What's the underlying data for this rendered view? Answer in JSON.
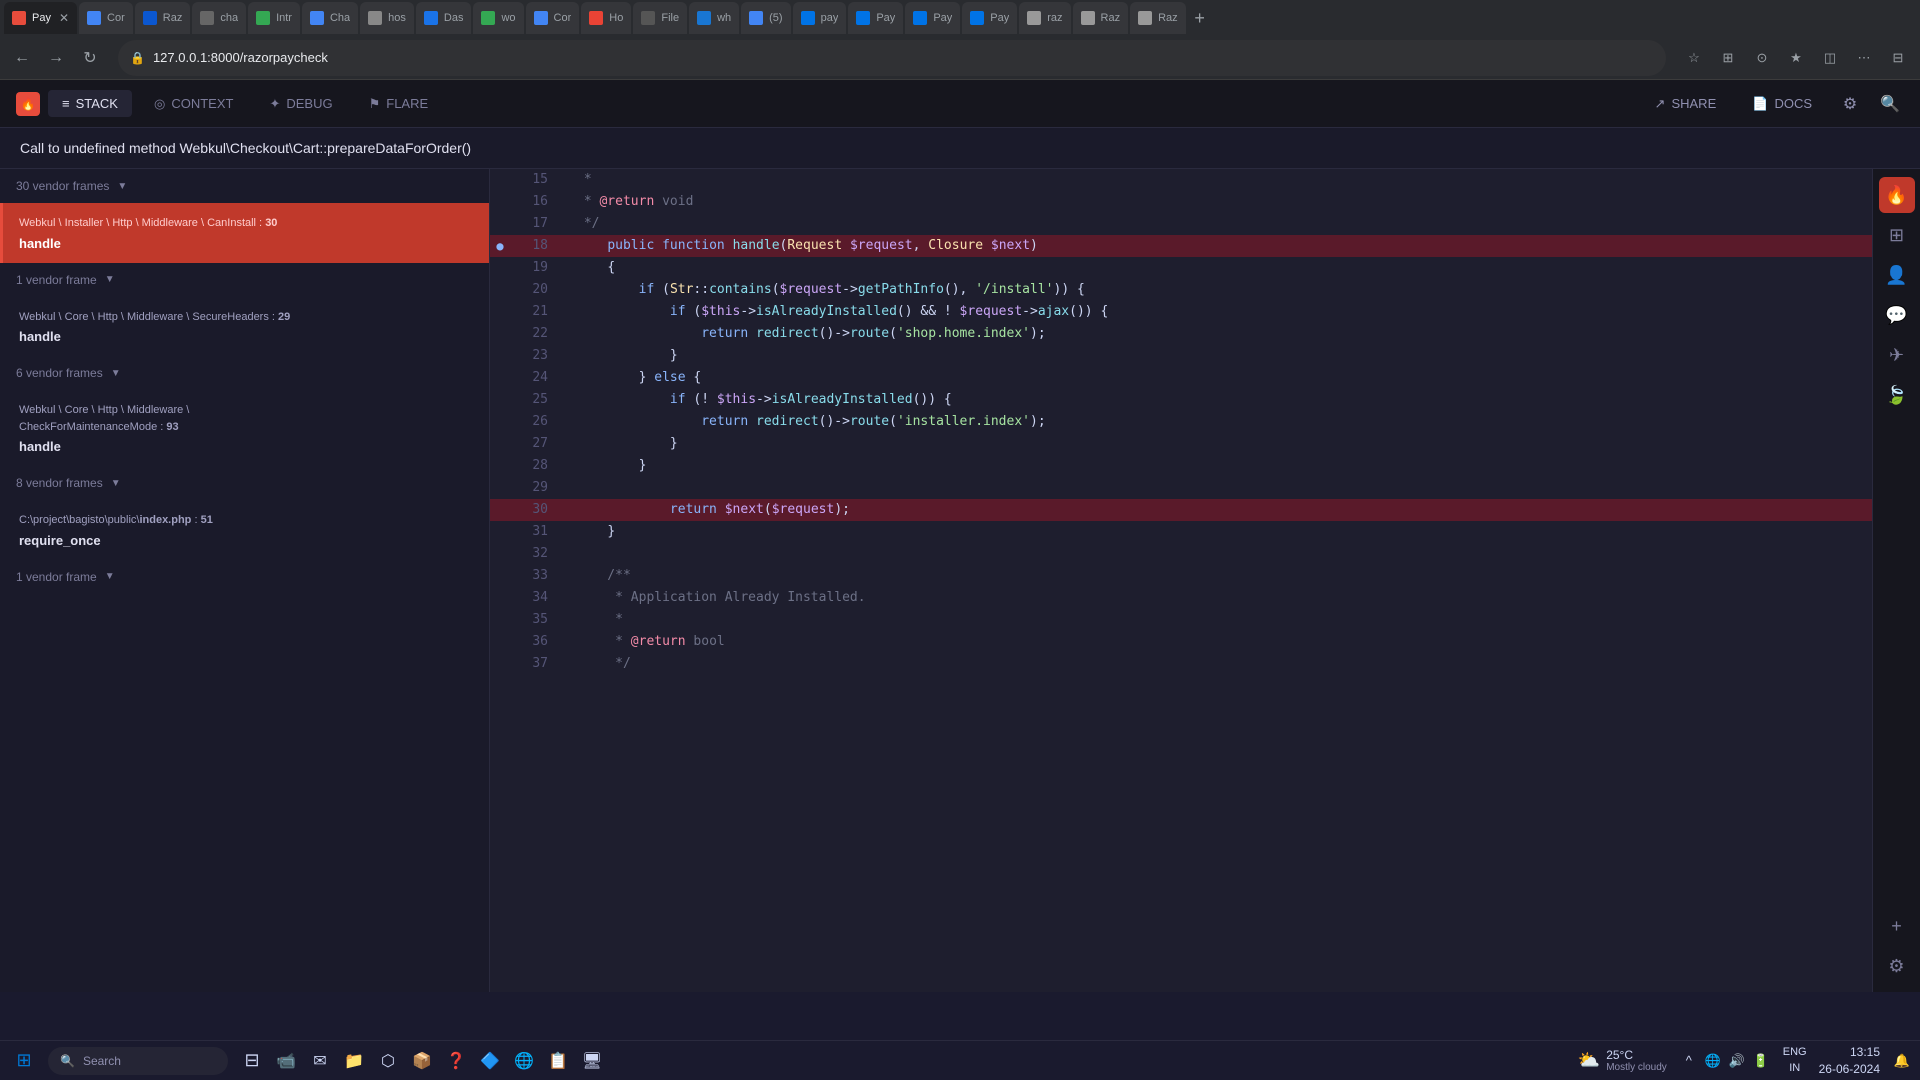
{
  "browser": {
    "url": "127.0.0.1:8000/razorpaycheck",
    "tabs": [
      {
        "label": "Cor",
        "active": false
      },
      {
        "label": "Raz",
        "active": false
      },
      {
        "label": "cha",
        "active": false
      },
      {
        "label": "Intr",
        "active": false
      },
      {
        "label": "Cha",
        "active": false
      },
      {
        "label": "hos",
        "active": false
      },
      {
        "label": "Das",
        "active": false
      },
      {
        "label": "wo",
        "active": false
      },
      {
        "label": "Cor",
        "active": false
      },
      {
        "label": "Ho",
        "active": false
      },
      {
        "label": "File",
        "active": false
      },
      {
        "label": "wh",
        "active": false
      },
      {
        "label": "(5)",
        "active": false
      },
      {
        "label": "pay",
        "active": false
      },
      {
        "label": "Pay",
        "active": false
      },
      {
        "label": "Pay",
        "active": false
      },
      {
        "label": "Pay",
        "active": false
      },
      {
        "label": "Pay",
        "active": true
      },
      {
        "label": "raz",
        "active": false
      },
      {
        "label": "Raz",
        "active": false
      },
      {
        "label": "Raz",
        "active": false
      }
    ]
  },
  "ignition": {
    "nav": {
      "tabs": [
        {
          "id": "stack",
          "label": "STACK",
          "icon": "≡",
          "active": true
        },
        {
          "id": "context",
          "label": "CONTEXT",
          "icon": "◎",
          "active": false
        },
        {
          "id": "debug",
          "label": "DEBUG",
          "icon": "✦",
          "active": false
        },
        {
          "id": "flare",
          "label": "FLARE",
          "icon": "⚑",
          "active": false
        }
      ],
      "share_label": "SHARE",
      "docs_label": "DOCS"
    },
    "error_message": "Call to undefined method Webkul\\Checkout\\Cart::prepareDataForOrder()",
    "stack_frames": [
      {
        "type": "group",
        "label": "30 vendor frames",
        "collapsed": true
      },
      {
        "type": "frame",
        "active": true,
        "path": "Webkul \\ Installer \\ Http \\ Middleware \\ CanInstall : 30",
        "method": "handle"
      },
      {
        "type": "group",
        "label": "1 vendor frame",
        "collapsed": true
      },
      {
        "type": "frame",
        "active": false,
        "path": "Webkul \\ Core \\ Http \\ Middleware \\ SecureHeaders : 29",
        "method": "handle"
      },
      {
        "type": "group",
        "label": "6 vendor frames",
        "collapsed": true
      },
      {
        "type": "frame",
        "active": false,
        "path": "Webkul \\ Core \\ Http \\ Middleware \\ CheckForMaintenanceMode : 93",
        "method": "handle"
      },
      {
        "type": "group",
        "label": "8 vendor frames",
        "collapsed": true
      },
      {
        "type": "frame",
        "active": false,
        "path": "C:\\project\\bagisto\\public\\index.php : 51",
        "method": "require_once"
      },
      {
        "type": "group",
        "label": "1 vendor frame",
        "collapsed": true
      }
    ],
    "code_lines": [
      {
        "num": 15,
        "content": " *",
        "highlight": false
      },
      {
        "num": 16,
        "content": " * @return void",
        "highlight": false,
        "has_return": true
      },
      {
        "num": 17,
        "content": " */",
        "highlight": false
      },
      {
        "num": 18,
        "content": "    public function handle(Request $request, Closure $next)",
        "highlight": true,
        "is_cursor": true
      },
      {
        "num": 19,
        "content": "    {",
        "highlight": false
      },
      {
        "num": 20,
        "content": "        if (Str::contains($request->getPathInfo(), '/install')) {",
        "highlight": false
      },
      {
        "num": 21,
        "content": "            if ($this->isAlreadyInstalled() && ! $request->ajax()) {",
        "highlight": false
      },
      {
        "num": 22,
        "content": "                return redirect()->route('shop.home.index');",
        "highlight": false
      },
      {
        "num": 23,
        "content": "            }",
        "highlight": false
      },
      {
        "num": 24,
        "content": "        } else {",
        "highlight": false
      },
      {
        "num": 25,
        "content": "            if (! $this->isAlreadyInstalled()) {",
        "highlight": false
      },
      {
        "num": 26,
        "content": "                return redirect()->route('installer.index');",
        "highlight": false
      },
      {
        "num": 27,
        "content": "            }",
        "highlight": false
      },
      {
        "num": 28,
        "content": "        }",
        "highlight": false
      },
      {
        "num": 29,
        "content": "",
        "highlight": false
      },
      {
        "num": 30,
        "content": "            return $next($request);",
        "highlight": true
      },
      {
        "num": 31,
        "content": "    }",
        "highlight": false
      },
      {
        "num": 32,
        "content": "",
        "highlight": false
      },
      {
        "num": 33,
        "content": "    /**",
        "highlight": false
      },
      {
        "num": 34,
        "content": "     * Application Already Installed.",
        "highlight": false
      },
      {
        "num": 35,
        "content": "     *",
        "highlight": false
      },
      {
        "num": 36,
        "content": "     * @return bool",
        "highlight": false,
        "has_return": true
      },
      {
        "num": 37,
        "content": "     */",
        "highlight": false
      }
    ]
  },
  "taskbar": {
    "weather": "25°C",
    "weather_desc": "Mostly cloudy",
    "time": "13:15",
    "date": "26-06-2024",
    "language": "ENG\nIN"
  }
}
